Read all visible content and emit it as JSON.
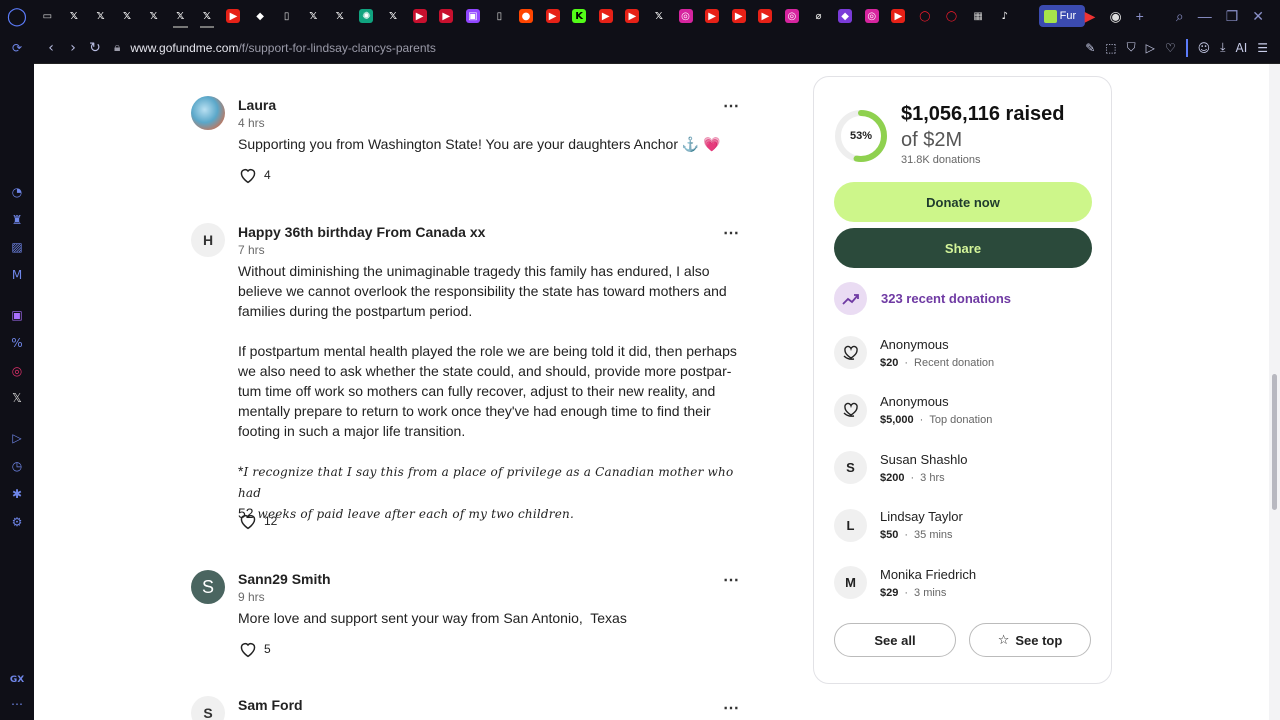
{
  "browser": {
    "tab_icons": [
      "game-icon",
      "x-icon",
      "x-icon",
      "x-icon",
      "x-icon",
      "x-icon",
      "x-icon",
      "youtube-icon",
      "news-icon",
      "doc-icon",
      "x-icon",
      "x-icon",
      "chatgpt-icon",
      "x-icon",
      "flag-icon",
      "flag-icon",
      "twitch-icon",
      "doc-icon",
      "reddit-icon",
      "youtube-icon",
      "kick-icon",
      "youtube-icon",
      "youtube-icon",
      "x-icon",
      "instagram-icon",
      "youtube-icon",
      "youtube-icon",
      "youtube-icon",
      "instagram-icon",
      "grok-icon",
      "app-icon",
      "instagram-icon",
      "youtube-icon",
      "opera-icon",
      "opera-icon",
      "grid-icon",
      "tiktok-icon"
    ],
    "current_tab_label": "Fur",
    "url_domain": "www.gofundme.com",
    "url_path": "/f/support-for-lindsay-clancys-parents",
    "ai_label": "AI"
  },
  "comments": [
    {
      "name": "Laura",
      "time": "4 hrs",
      "avatar_type": "photo",
      "text": "Supporting you from Washington State! You are your daughters Anchor ⚓ 💗",
      "likes": "4"
    },
    {
      "name": "Happy 36th birthday From Canada xx",
      "time": "7 hrs",
      "avatar_letter": "H",
      "text_p1": "Without diminishing the unimaginable tragedy this family has endured, I also believe we cannot overlook the responsibility the state has toward mothers and families during the postpartum period.",
      "text_p2": "If postpartum mental health played the role we are being told it did, then perhaps we also need to ask whether the state could, and should, provide more postpar-tum time off work so mothers can fully recover, adjust to their new reality, and mentally prepare to return to work once they've had enough time to find their footing in such a major life transition.",
      "text_p3_star": "*",
      "text_p3_italic_a": "I recognize that I say this from a place of privilege as a Canadian mother who had",
      "text_p3_num": "52",
      "text_p3_italic_b": "weeks of paid leave after each of my two children.",
      "likes": "12"
    },
    {
      "name": "Sann29 Smith",
      "time": "9 hrs",
      "avatar_letter": "S",
      "text": "More love and support sent your way from San Antonio,  Texas",
      "likes": "5"
    },
    {
      "name": "Sam Ford",
      "avatar_letter": "S"
    }
  ],
  "fundraiser": {
    "percent": 53,
    "percent_label": "53%",
    "raised": "$1,056,116 raised",
    "goal": "of $2M",
    "donation_count": "31.8K donations",
    "donate_label": "Donate now",
    "share_label": "Share",
    "recent_label": "323 recent donations",
    "donors": [
      {
        "name": "Anonymous",
        "amount": "$20",
        "note": "Recent donation",
        "avatar": "heart-hand-icon"
      },
      {
        "name": "Anonymous",
        "amount": "$5,000",
        "note": "Top donation",
        "avatar": "heart-hand-icon"
      },
      {
        "name": "Susan Shashlo",
        "amount": "$200",
        "note": "3 hrs",
        "letter": "S"
      },
      {
        "name": "Lindsay Taylor",
        "amount": "$50",
        "note": "35 mins",
        "letter": "L"
      },
      {
        "name": "Monika Friedrich",
        "amount": "$29",
        "note": "3 mins",
        "letter": "M"
      }
    ],
    "see_all_label": "See all",
    "see_top_label": "See top"
  },
  "colors": {
    "donate_bg": "#cdf68a",
    "share_bg": "#2b4a3b",
    "ring_progress": "#8fd14f",
    "accent_purple": "#6f3aa3"
  }
}
